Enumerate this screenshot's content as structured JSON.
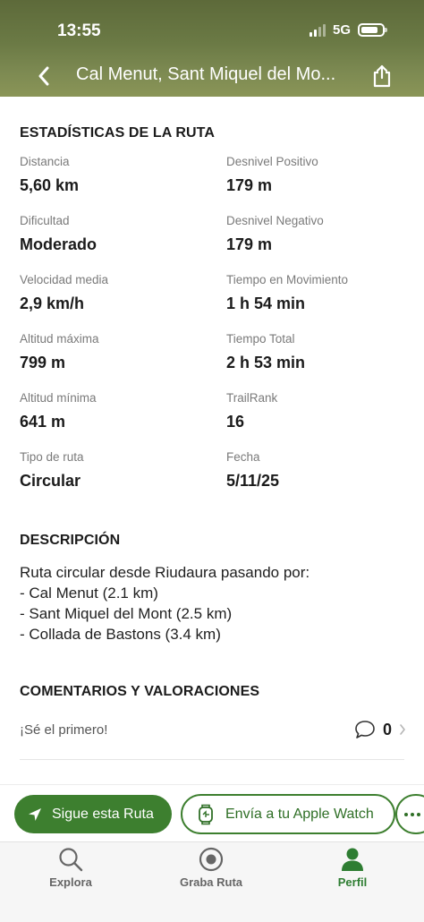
{
  "status_bar": {
    "time": "13:55",
    "network": "5G"
  },
  "header": {
    "title": "Cal Menut, Sant Miquel del Mo..."
  },
  "stats": {
    "section_title": "ESTADÍSTICAS DE LA RUTA",
    "items": [
      {
        "label": "Distancia",
        "value": "5,60 km"
      },
      {
        "label": "Desnivel Positivo",
        "value": "179 m"
      },
      {
        "label": "Dificultad",
        "value": "Moderado"
      },
      {
        "label": "Desnivel Negativo",
        "value": "179 m"
      },
      {
        "label": "Velocidad media",
        "value": "2,9 km/h"
      },
      {
        "label": "Tiempo en Movimiento",
        "value": "1 h 54 min"
      },
      {
        "label": "Altitud máxima",
        "value": "799 m"
      },
      {
        "label": "Tiempo Total",
        "value": "2 h 53 min"
      },
      {
        "label": "Altitud mínima",
        "value": "641 m"
      },
      {
        "label": "TrailRank",
        "value": "16"
      },
      {
        "label": "Tipo de ruta",
        "value": "Circular"
      },
      {
        "label": "Fecha",
        "value": "5/11/25"
      }
    ]
  },
  "description": {
    "section_title": "DESCRIPCIÓN",
    "lines": [
      "Ruta circular desde Riudaura pasando por:",
      "- Cal Menut (2.1 km)",
      "- Sant Miquel del Mont (2.5 km)",
      "- Collada de Bastons (3.4 km)"
    ]
  },
  "comments": {
    "section_title": "COMENTARIOS Y VALORACIONES",
    "first_prompt": "¡Sé el primero!",
    "count": "0"
  },
  "actions": {
    "follow_label": "Sigue esta Ruta",
    "watch_label": "Envía a tu Apple Watch"
  },
  "tabs": [
    {
      "label": "Explora",
      "icon": "search-icon"
    },
    {
      "label": "Graba Ruta",
      "icon": "record-icon"
    },
    {
      "label": "Perfil",
      "icon": "profile-icon"
    }
  ],
  "colors": {
    "accent": "#3d7f2f",
    "active_tab": "#2e7d32"
  }
}
